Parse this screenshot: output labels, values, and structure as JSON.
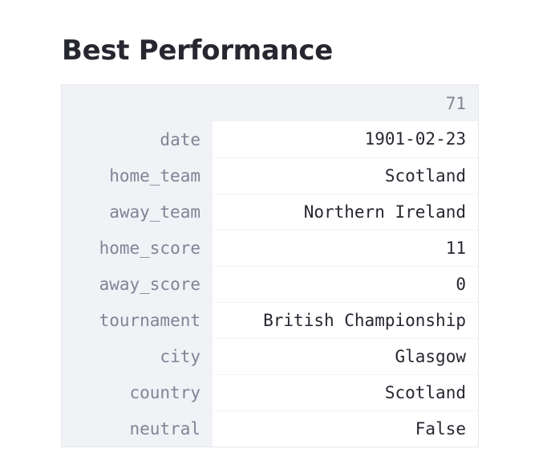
{
  "page": {
    "title": "Best Performance"
  },
  "table": {
    "column_header": "71",
    "rows": [
      {
        "key": "date",
        "value": "1901-02-23"
      },
      {
        "key": "home_team",
        "value": "Scotland"
      },
      {
        "key": "away_team",
        "value": "Northern Ireland"
      },
      {
        "key": "home_score",
        "value": "11"
      },
      {
        "key": "away_score",
        "value": "0"
      },
      {
        "key": "tournament",
        "value": "British Championship"
      },
      {
        "key": "city",
        "value": "Glasgow"
      },
      {
        "key": "country",
        "value": "Scotland"
      },
      {
        "key": "neutral",
        "value": "False"
      }
    ]
  },
  "colors": {
    "text": "#262730",
    "index_text": "#808495",
    "header_bg": "#f0f2f6",
    "cell_bg": "#ffffff"
  }
}
